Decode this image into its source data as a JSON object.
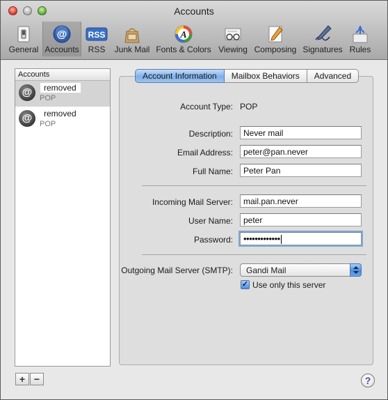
{
  "window": {
    "title": "Accounts"
  },
  "toolbar": {
    "items": [
      {
        "label": "General",
        "icon": "light-switch-icon"
      },
      {
        "label": "Accounts",
        "icon": "at-sign-icon"
      },
      {
        "label": "RSS",
        "icon": "rss-icon"
      },
      {
        "label": "Junk Mail",
        "icon": "junk-mail-bag-icon"
      },
      {
        "label": "Fonts & Colors",
        "icon": "fonts-colors-icon"
      },
      {
        "label": "Viewing",
        "icon": "eyeglasses-icon"
      },
      {
        "label": "Composing",
        "icon": "pencil-paper-icon"
      },
      {
        "label": "Signatures",
        "icon": "signature-pen-icon"
      },
      {
        "label": "Rules",
        "icon": "rules-arrows-icon"
      }
    ],
    "selected": "Accounts"
  },
  "sidebar": {
    "header": "Accounts",
    "accounts": [
      {
        "name": "removed",
        "type": "POP",
        "selected": true
      },
      {
        "name": "removed",
        "type": "POP",
        "selected": false
      }
    ],
    "add_label": "+",
    "remove_label": "−"
  },
  "tabs": [
    {
      "label": "Account Information",
      "active": true
    },
    {
      "label": "Mailbox Behaviors",
      "active": false
    },
    {
      "label": "Advanced",
      "active": false
    }
  ],
  "form": {
    "account_type_label": "Account Type:",
    "account_type_value": "POP",
    "description_label": "Description:",
    "description_value": "Never mail",
    "email_label": "Email Address:",
    "email_value": "peter@pan.never",
    "fullname_label": "Full Name:",
    "fullname_value": "Peter Pan",
    "incoming_label": "Incoming Mail Server:",
    "incoming_value": "mail.pan.never",
    "username_label": "User Name:",
    "username_value": "peter",
    "password_label": "Password:",
    "password_value": "•••••••••••••",
    "smtp_label": "Outgoing Mail Server (SMTP):",
    "smtp_value": "Gandi Mail",
    "only_server_label": "Use only this server",
    "only_server_checked": true
  },
  "help_label": "?",
  "colors": {
    "accent": "#5b8fd8",
    "window_bg": "#e8e8e8"
  }
}
